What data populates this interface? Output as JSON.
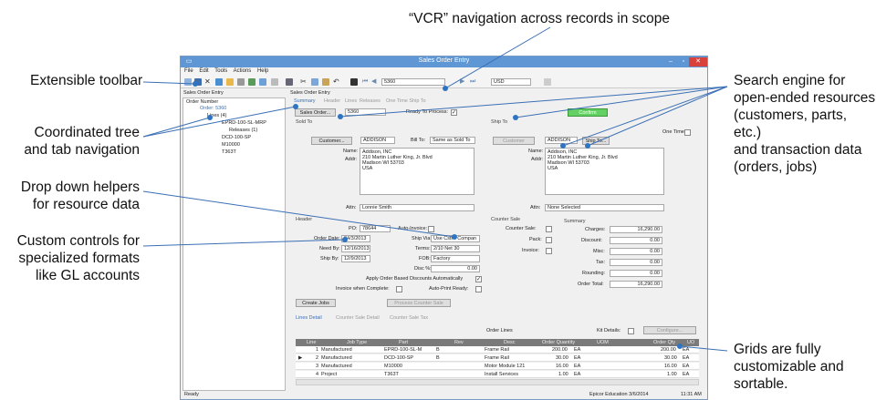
{
  "callouts": {
    "vcr": "“VCR” navigation across records in scope",
    "toolbar": "Extensible toolbar",
    "tree1": "Coordinated tree",
    "tree2": "and tab navigation",
    "dropdown1": "Drop down helpers",
    "dropdown2": "for resource data",
    "custom1": "Custom controls for",
    "custom2": "specialized formats",
    "custom3": "like GL accounts",
    "search1": "Search engine for",
    "search2": "open-ended resources",
    "search3": "(customers, parts, etc.)",
    "search4": "and transaction data",
    "search5": "(orders, jobs)",
    "grids1": "Grids are fully",
    "grids2": "customizable and",
    "grids3": "sortable."
  },
  "window": {
    "title": "Sales Order Entry",
    "menu": [
      "File",
      "Edit",
      "Tools",
      "Actions",
      "Help"
    ],
    "record": "5360",
    "currency": "USD"
  },
  "tree": {
    "panel_title": "Sales Order Entry",
    "items": [
      "Order Number",
      "Order: 5360",
      "Lines (4)",
      "EPRD-100-SL-MRP",
      "Releases (1)",
      "DCD-100-SP",
      "M10000",
      "T363T"
    ]
  },
  "form": {
    "panel_title": "Sales Order Entry",
    "tabs": [
      "Summary",
      "Header",
      "Lines",
      "Releases",
      "One Time Ship To"
    ],
    "sales_order_btn": "Sales Order...",
    "sales_order": "5360",
    "ready_label": "Ready To Process:",
    "confirm": "Confirm",
    "sold_to": "Sold To",
    "ship_to": "Ship To",
    "one_time": "One Time:",
    "customer_btn": "Customer...",
    "customer": "ADDISON",
    "bill_to_label": "Bill To:",
    "bill_to": "Same as Sold To",
    "name_label": "Name:",
    "addr_label": "Addr:",
    "sold_addr": [
      "Addison, INC",
      "210 Martin Luther King, Jr. Blvd",
      "Madison WI 53703",
      "USA"
    ],
    "ship_customer_btn": "Customer",
    "ship_customer": "ADDISON",
    "ship_to_btn": "Ship To...",
    "ship_addr": [
      "Addison, INC",
      "210 Martin Luther King, Jr. Blvd",
      "Madison WI 53703",
      "USA"
    ],
    "attn_label": "Attn:",
    "attn": "Lonnie Smith",
    "ship_attn": "None Selected",
    "header": "Header",
    "po_label": "PO:",
    "po": "78644",
    "auto_invoice": "Auto-Invoice:",
    "order_date_label": "Order Date:",
    "order_date": "04/3/2013",
    "ship_via_label": "Ship Via:",
    "ship_via": "Use Cstr - Compan",
    "need_by_label": "Need By:",
    "need_by": "12/16/2013",
    "terms_label": "Terms:",
    "terms": "2/10 Net 30",
    "ship_by_label": "Ship By:",
    "ship_by": "12/9/2013",
    "fob_label": "FOB:",
    "fob": "Factory",
    "disc_label": "Disc %:",
    "disc": "0.00",
    "apply_disc": "Apply Order Based Discounts Automatically",
    "invoice_complete": "Invoice when Complete:",
    "auto_print": "Auto-Print Ready:",
    "create_jobs": "Create Jobs",
    "process_counter": "Process Counter Sale",
    "counter_sale": "Counter Sale",
    "counter_sale_label": "Counter Sale:",
    "pack_label": "Pack:",
    "invoice_label": "Invoice:",
    "summary": "Summary",
    "summary_rows": [
      {
        "label": "Charges:",
        "value": "16,290.00"
      },
      {
        "label": "Discount:",
        "value": "0.00"
      },
      {
        "label": "Misc:",
        "value": "0.00"
      },
      {
        "label": "Tax:",
        "value": "0.00"
      },
      {
        "label": "Rounding:",
        "value": "0.00"
      },
      {
        "label": "Order Total:",
        "value": "16,290.00"
      }
    ],
    "lower_tabs": [
      "Lines Detail",
      "Counter Sale Detail",
      "Counter Sale Tax"
    ],
    "order_lines": "Order Lines",
    "kit_details": "Kit Details:",
    "configure": "Configure..."
  },
  "grid": {
    "headers": [
      "Line",
      "Job Type",
      "Part",
      "Rev",
      "Desc",
      "Order Quantity",
      "UOM",
      "Order Qty",
      "UO"
    ],
    "rows": [
      [
        "1",
        "Manufactured",
        "EPRD-100-SL-M",
        "B",
        "Frame Rail",
        "200.00",
        "EA",
        "200.00",
        "EA"
      ],
      [
        "2",
        "Manufactured",
        "DCD-100-SP",
        "B",
        "Frame Rail",
        "30.00",
        "EA",
        "30.00",
        "EA"
      ],
      [
        "3",
        "Manufactured",
        "M10000",
        "",
        "Motor Module 121",
        "16.00",
        "EA",
        "16.00",
        "EA"
      ],
      [
        "4",
        "Project",
        "T363T",
        "",
        "Install Services",
        "1.00",
        "EA",
        "1.00",
        "EA"
      ]
    ]
  },
  "status": {
    "left": "Ready",
    "right": "Epicor Education  3/6/2014",
    "time": "11:31 AM"
  }
}
